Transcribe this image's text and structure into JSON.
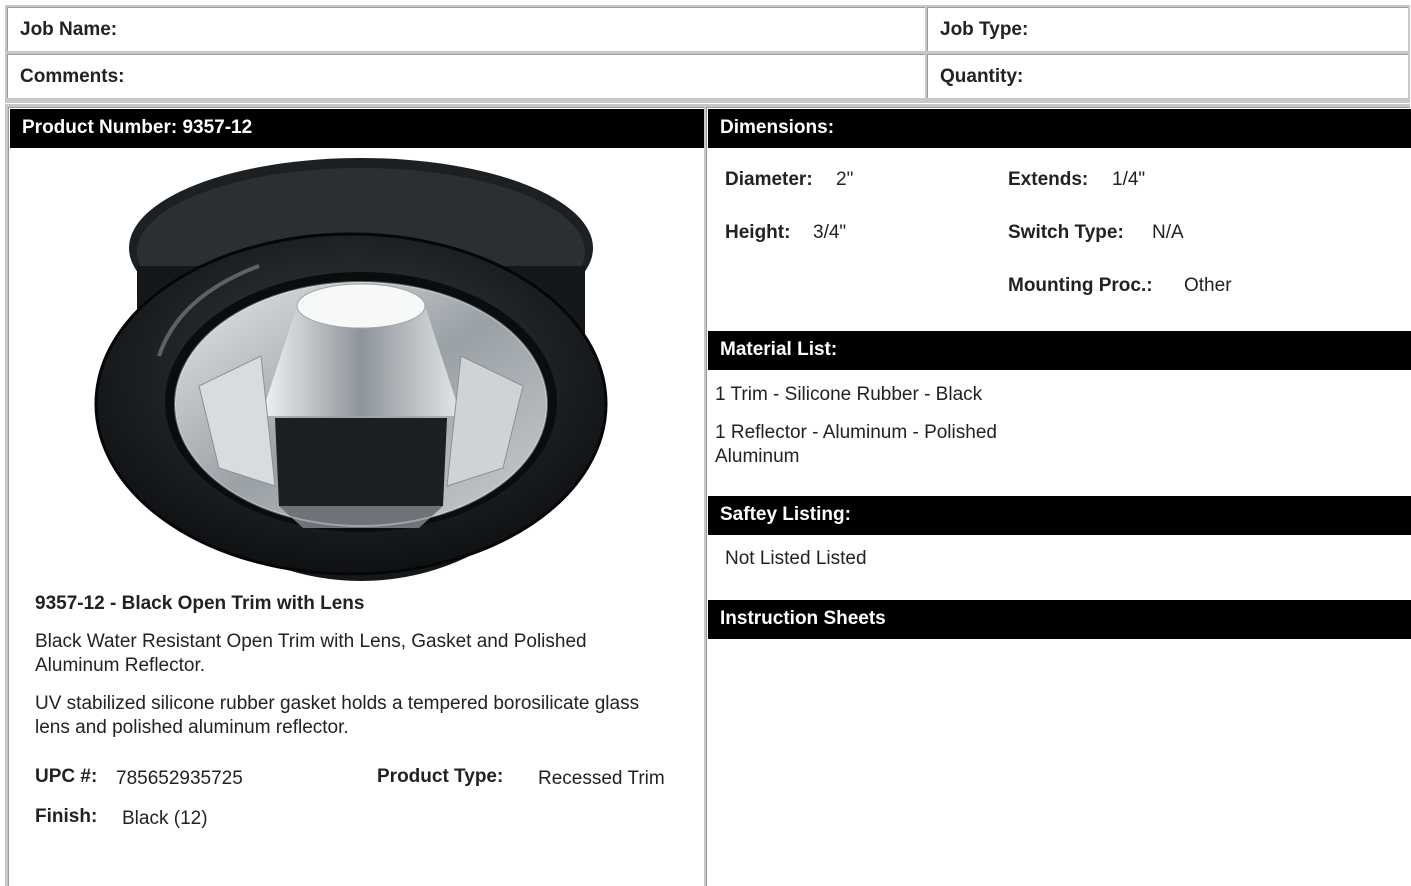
{
  "header": {
    "job_name_label": "Job Name:",
    "job_type_label": "Job Type:",
    "comments_label": "Comments:",
    "quantity_label": "Quantity:"
  },
  "product": {
    "heading": "Product Number: 9357-12",
    "title": "9357-12 - Black Open Trim with Lens",
    "description_1": "Black Water Resistant Open Trim with Lens, Gasket and Polished Aluminum Reflector.",
    "description_2": "UV stabilized silicone rubber gasket holds a tempered borosilicate glass lens and polished aluminum reflector.",
    "upc_label": "UPC #:",
    "upc_value": "785652935725",
    "type_label": "Product Type:",
    "type_value": "Recessed Trim",
    "finish_label": "Finish:",
    "finish_value": "Black (12)"
  },
  "dimensions": {
    "heading": "Dimensions:",
    "diameter_label": "Diameter:",
    "diameter_value": "2\"",
    "extends_label": "Extends:",
    "extends_value": "1/4\"",
    "height_label": "Height:",
    "height_value": "3/4\"",
    "switch_label": "Switch Type:",
    "switch_value": "N/A",
    "mounting_label": "Mounting Proc.:",
    "mounting_value": "Other"
  },
  "materials": {
    "heading": "Material List:",
    "items": [
      "1 Trim - Silicone Rubber - Black",
      "1 Reflector - Aluminum - Polished Aluminum"
    ]
  },
  "safety": {
    "heading": "Saftey Listing:",
    "value": "Not Listed Listed"
  },
  "instructions": {
    "heading": "Instruction Sheets"
  }
}
